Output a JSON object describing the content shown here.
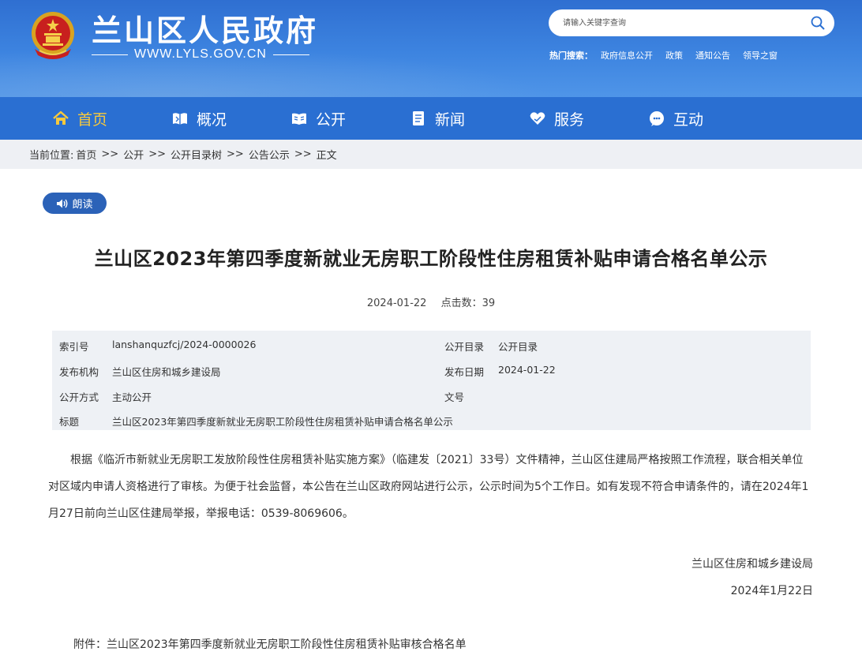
{
  "header": {
    "title": "兰山区人民政府",
    "url": "WWW.LYLS.GOV.CN",
    "search_placeholder": "请输入关键字查询",
    "hot_label": "热门搜索：",
    "hot_words": [
      "政府信息公开",
      "政策",
      "通知公告",
      "领导之窗"
    ]
  },
  "nav": {
    "items": [
      {
        "label": "首页",
        "icon": "home-icon"
      },
      {
        "label": "概况",
        "icon": "overview-icon"
      },
      {
        "label": "公开",
        "icon": "book-icon"
      },
      {
        "label": "新闻",
        "icon": "news-icon"
      },
      {
        "label": "服务",
        "icon": "heart-hand-icon"
      },
      {
        "label": "互动",
        "icon": "chat-icon"
      }
    ]
  },
  "breadcrumb": {
    "prefix": "当前位置:",
    "items": [
      "首页",
      "公开",
      "公开目录树",
      "公告公示",
      "正文"
    ],
    "separator": ">>"
  },
  "article": {
    "read_label": "朗读",
    "title": "兰山区2023年第四季度新就业无房职工阶段性住房租赁补贴申请合格名单公示",
    "date": "2024-01-22",
    "clicks": "点击数：39",
    "info": {
      "index_label": "索引号",
      "index_value": "lanshanquzfcj/2024-0000026",
      "catalog_label": "公开目录",
      "catalog_value": "公开目录",
      "org_label": "发布机构",
      "org_value": "兰山区住房和城乡建设局",
      "pubdate_label": "发布日期",
      "pubdate_value": "2024-01-22",
      "mode_label": "公开方式",
      "mode_value": "主动公开",
      "docno_label": "文号",
      "docno_value": "",
      "subject_label": "标题",
      "subject_value": "兰山区2023年第四季度新就业无房职工阶段性住房租赁补贴申请合格名单公示"
    },
    "body": "根据《临沂市新就业无房职工发放阶段性住房租赁补贴实施方案》（临建发〔2021〕33号）文件精神，兰山区住建局严格按照工作流程，联合相关单位对区域内申请人资格进行了审核。为便于社会监督，本公告在兰山区政府网站进行公示，公示时间为5个工作日。如有发现不符合申请条件的，请在2024年1月27日前向兰山区住建局举报，举报电话：0539-8069606。",
    "sign_org": "兰山区住房和城乡建设局",
    "sign_date": "2024年1月22日",
    "attachment_prefix": "附件：",
    "attachment_name": "兰山区2023年第四季度新就业无房职工阶段性住房租赁补贴审核合格名单"
  },
  "colors": {
    "header_blue": "#3d84e0",
    "nav_blue": "#2a6fd2",
    "nav_active": "#f7c93c",
    "read_button": "#2b62b8",
    "info_bg": "#eef1f5"
  }
}
